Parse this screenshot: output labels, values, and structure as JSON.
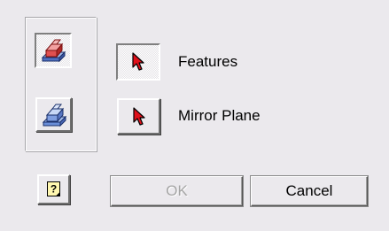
{
  "dialog": {
    "selectors": [
      {
        "label": "Features",
        "mode_icon": "extrude-feature-icon",
        "select_icon": "red-arrow-select-icon",
        "mode_active": true,
        "select_active": true
      },
      {
        "label": "Mirror Plane",
        "mode_icon": "mirror-plane-icon",
        "select_icon": "red-arrow-select-icon",
        "mode_active": false,
        "select_active": false
      }
    ],
    "buttons": {
      "help_icon": "help-question-icon",
      "ok_label": "OK",
      "ok_enabled": false,
      "cancel_label": "Cancel"
    },
    "colors": {
      "background": "#ebe9ed",
      "select_arrow": "#e0101a",
      "feature_red": "#e05050",
      "feature_blue": "#6a8ed8"
    }
  }
}
